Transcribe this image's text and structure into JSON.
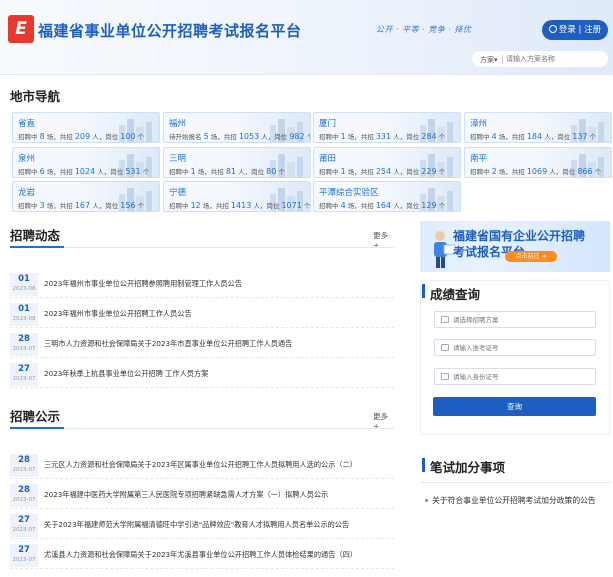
{
  "header": {
    "logo_glyph": "E",
    "title": "福建省事业单位公开招聘考试报名平台",
    "slogan": "公开 · 平等 · 竞争 · 择优",
    "login_label": "登录 | 注册",
    "search": {
      "select_label": "方案",
      "placeholder": "请输入方案名称"
    }
  },
  "city_nav": {
    "title": "地市导航",
    "cities": [
      {
        "name": "省直",
        "prefix": "招聘中",
        "recruits": "8",
        "total": "209",
        "posts": "100"
      },
      {
        "name": "福州",
        "prefix": "待开始报名",
        "recruits": "5",
        "total": "1053",
        "posts": "982"
      },
      {
        "name": "厦门",
        "prefix": "招聘中",
        "recruits": "1",
        "total": "331",
        "posts": "284"
      },
      {
        "name": "漳州",
        "prefix": "招聘中",
        "recruits": "4",
        "total": "184",
        "posts": "137"
      },
      {
        "name": "泉州",
        "prefix": "招聘中",
        "recruits": "6",
        "total": "1024",
        "posts": "531"
      },
      {
        "name": "三明",
        "prefix": "招聘中",
        "recruits": "1",
        "total": "81",
        "posts": "80"
      },
      {
        "name": "莆田",
        "prefix": "招聘中",
        "recruits": "1",
        "total": "254",
        "posts": "229"
      },
      {
        "name": "南平",
        "prefix": "招聘中",
        "recruits": "2",
        "total": "1069",
        "posts": "866"
      },
      {
        "name": "龙岩",
        "prefix": "招聘中",
        "recruits": "3",
        "total": "167",
        "posts": "156"
      },
      {
        "name": "宁德",
        "prefix": "招聘中",
        "recruits": "12",
        "total": "1413",
        "posts": "1071"
      },
      {
        "name": "平潭综合实验区",
        "prefix": "招聘中",
        "recruits": "4",
        "total": "164",
        "posts": "129"
      }
    ],
    "labels": {
      "count_unit": "场，共招",
      "people_unit": "人，岗位",
      "post_unit": "个"
    }
  },
  "dynamics": {
    "title": "招聘动态",
    "more": "更多+",
    "items": [
      {
        "day": "01",
        "ym": "2023-08",
        "title": "2023年福州市事业单位公开招聘参照聘用制管理工作人员公告"
      },
      {
        "day": "01",
        "ym": "2023-08",
        "title": "2023年福州市事业单位公开招聘工作人员公告"
      },
      {
        "day": "28",
        "ym": "2023-07",
        "title": "三明市人力资源和社会保障局关于2023年市直事业单位公开招聘工作人员通告"
      },
      {
        "day": "27",
        "ym": "2023-07",
        "title": "2023年秋季上杭县事业单位公开招聘 工作人员方案"
      }
    ]
  },
  "notices": {
    "title": "招聘公示",
    "more": "更多+",
    "items": [
      {
        "day": "28",
        "ym": "2023-07",
        "title": "三元区人力资源和社会保障局关于2023年区属事业单位公开招聘工作人员拟聘用人选的公示（二）"
      },
      {
        "day": "28",
        "ym": "2023-07",
        "title": "2023年福建中医药大学附属第三人民医院专项招聘紧缺急需人才方案（一）拟聘人员公示"
      },
      {
        "day": "27",
        "ym": "2023-07",
        "title": "关于2023年福建师范大学附属福清德旺中学引进\"品牌效应\"教育人才拟聘用人员名单公示的公告"
      },
      {
        "day": "27",
        "ym": "2023-07",
        "title": "尤溪县人力资源和社会保障局关于2023年尤溪县事业单位公开招聘工作人员体检结果的通告（四）"
      }
    ]
  },
  "banner": {
    "line1": "福建省国有企业公开招聘",
    "line2": "考试报名平台",
    "button": "点击前往"
  },
  "score_query": {
    "title": "成绩查询",
    "fields": [
      "请选择招聘方案",
      "请输入准考证号",
      "请输入身份证号"
    ],
    "button": "查询"
  },
  "bonus": {
    "title": "笔试加分事项",
    "items": [
      "关于符合事业单位公开招聘考试加分政策的公告"
    ]
  },
  "colors": {
    "primary": "#1d5fc0",
    "accent": "#1d6fd8",
    "orange": "#ff8a1d",
    "logo_red": "#e8392f"
  }
}
